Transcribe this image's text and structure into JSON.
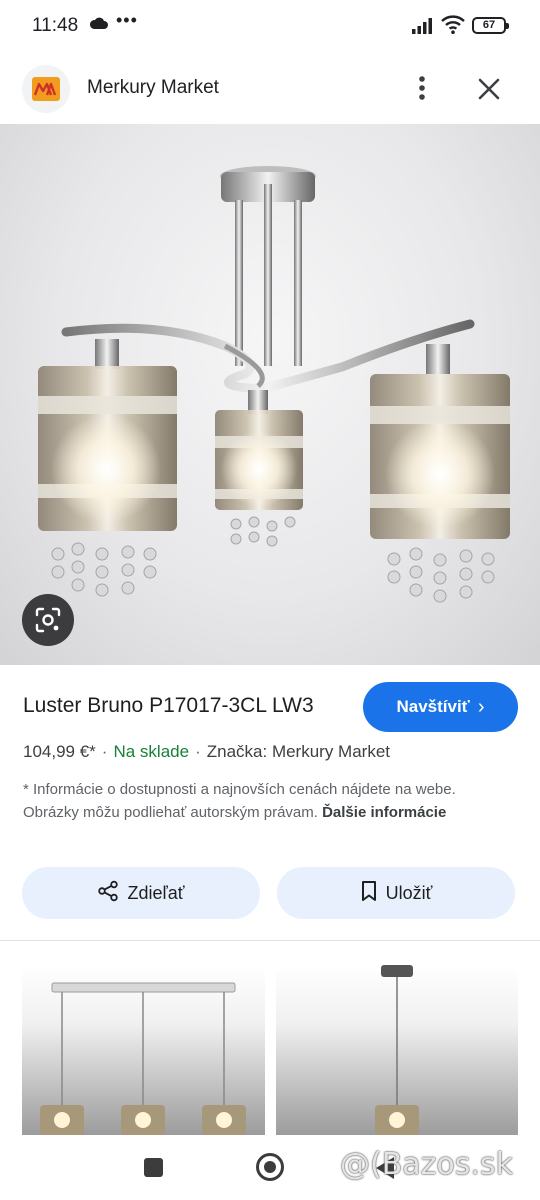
{
  "status_bar": {
    "time": "11:48",
    "dots": "•••",
    "battery": "67"
  },
  "header": {
    "merchant_name": "Merkury Market"
  },
  "product": {
    "title": "Luster Bruno P17017-3CL LW3",
    "visit_label": "Navštíviť",
    "price": "104,99 €*",
    "availability": "Na sklade",
    "brand": "Značka: Merkury Market",
    "separator": "·",
    "disclaimer": "* Informácie o dostupnosti a najnovších cenách nájdete na webe. Obrázky môžu podliehať autorským právam.",
    "more_info": "Ďalšie informácie"
  },
  "actions": {
    "share_label": "Zdieľať",
    "save_label": "Uložiť"
  },
  "watermark": "@(Bazos.sk",
  "colors": {
    "accent": "#1a73e8",
    "in_stock": "#188038",
    "button_bg": "#e8f0fe"
  }
}
